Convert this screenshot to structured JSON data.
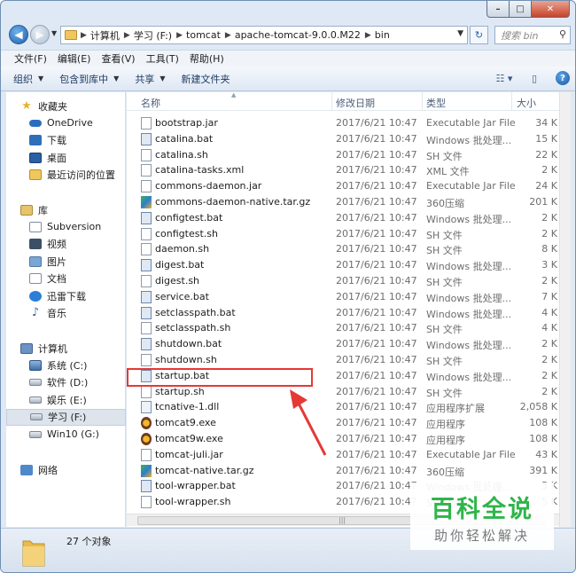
{
  "window": {
    "captions": {
      "min": "–",
      "max": "□",
      "close": "✕"
    }
  },
  "address": {
    "breadcrumbs": [
      "计算机",
      "学习 (F:)",
      "tomcat",
      "apache-tomcat-9.0.0.M22",
      "bin"
    ],
    "search_placeholder": "搜索 bin"
  },
  "menu": [
    "文件(F)",
    "编辑(E)",
    "查看(V)",
    "工具(T)",
    "帮助(H)"
  ],
  "toolbar": {
    "organize": "组织",
    "include_library": "包含到库中",
    "share": "共享",
    "new_folder": "新建文件夹"
  },
  "nav": {
    "favorites": {
      "title": "收藏夹",
      "items": [
        "OneDrive",
        "下载",
        "桌面",
        "最近访问的位置"
      ]
    },
    "library": {
      "title": "库",
      "items": [
        "Subversion",
        "视频",
        "图片",
        "文档",
        "迅雷下载",
        "音乐"
      ]
    },
    "computer": {
      "title": "计算机",
      "items": [
        "系统 (C:)",
        "软件 (D:)",
        "娱乐 (E:)",
        "学习 (F:)",
        "Win10 (G:)"
      ]
    },
    "network": {
      "title": "网络"
    }
  },
  "columns": {
    "name": "名称",
    "date": "修改日期",
    "type": "类型",
    "size": "大小"
  },
  "files": [
    {
      "name": "bootstrap.jar",
      "date": "2017/6/21 10:47",
      "type": "Executable Jar File",
      "size": "34 K",
      "icon": "file"
    },
    {
      "name": "catalina.bat",
      "date": "2017/6/21 10:47",
      "type": "Windows 批处理...",
      "size": "15 K",
      "icon": "bat"
    },
    {
      "name": "catalina.sh",
      "date": "2017/6/21 10:47",
      "type": "SH 文件",
      "size": "22 K",
      "icon": "file"
    },
    {
      "name": "catalina-tasks.xml",
      "date": "2017/6/21 10:47",
      "type": "XML 文件",
      "size": "2 K",
      "icon": "file"
    },
    {
      "name": "commons-daemon.jar",
      "date": "2017/6/21 10:47",
      "type": "Executable Jar File",
      "size": "24 K",
      "icon": "file"
    },
    {
      "name": "commons-daemon-native.tar.gz",
      "date": "2017/6/21 10:47",
      "type": "360压缩",
      "size": "201 K",
      "icon": "gz"
    },
    {
      "name": "configtest.bat",
      "date": "2017/6/21 10:47",
      "type": "Windows 批处理...",
      "size": "2 K",
      "icon": "bat"
    },
    {
      "name": "configtest.sh",
      "date": "2017/6/21 10:47",
      "type": "SH 文件",
      "size": "2 K",
      "icon": "file"
    },
    {
      "name": "daemon.sh",
      "date": "2017/6/21 10:47",
      "type": "SH 文件",
      "size": "8 K",
      "icon": "file"
    },
    {
      "name": "digest.bat",
      "date": "2017/6/21 10:47",
      "type": "Windows 批处理...",
      "size": "3 K",
      "icon": "bat"
    },
    {
      "name": "digest.sh",
      "date": "2017/6/21 10:47",
      "type": "SH 文件",
      "size": "2 K",
      "icon": "file"
    },
    {
      "name": "service.bat",
      "date": "2017/6/21 10:47",
      "type": "Windows 批处理...",
      "size": "7 K",
      "icon": "bat"
    },
    {
      "name": "setclasspath.bat",
      "date": "2017/6/21 10:47",
      "type": "Windows 批处理...",
      "size": "4 K",
      "icon": "bat"
    },
    {
      "name": "setclasspath.sh",
      "date": "2017/6/21 10:47",
      "type": "SH 文件",
      "size": "4 K",
      "icon": "file"
    },
    {
      "name": "shutdown.bat",
      "date": "2017/6/21 10:47",
      "type": "Windows 批处理...",
      "size": "2 K",
      "icon": "bat"
    },
    {
      "name": "shutdown.sh",
      "date": "2017/6/21 10:47",
      "type": "SH 文件",
      "size": "2 K",
      "icon": "file"
    },
    {
      "name": "startup.bat",
      "date": "2017/6/21 10:47",
      "type": "Windows 批处理...",
      "size": "2 K",
      "icon": "bat"
    },
    {
      "name": "startup.sh",
      "date": "2017/6/21 10:47",
      "type": "SH 文件",
      "size": "2 K",
      "icon": "file"
    },
    {
      "name": "tcnative-1.dll",
      "date": "2017/6/21 10:47",
      "type": "应用程序扩展",
      "size": "2,058 K",
      "icon": "dll"
    },
    {
      "name": "tomcat9.exe",
      "date": "2017/6/21 10:47",
      "type": "应用程序",
      "size": "108 K",
      "icon": "exe"
    },
    {
      "name": "tomcat9w.exe",
      "date": "2017/6/21 10:47",
      "type": "应用程序",
      "size": "108 K",
      "icon": "exe"
    },
    {
      "name": "tomcat-juli.jar",
      "date": "2017/6/21 10:47",
      "type": "Executable Jar File",
      "size": "43 K",
      "icon": "file"
    },
    {
      "name": "tomcat-native.tar.gz",
      "date": "2017/6/21 10:47",
      "type": "360压缩",
      "size": "391 K",
      "icon": "gz"
    },
    {
      "name": "tool-wrapper.bat",
      "date": "2017/6/21 10:47",
      "type": "Windows 批处理...",
      "size": "5 K",
      "icon": "bat"
    },
    {
      "name": "tool-wrapper.sh",
      "date": "2017/6/21 10:47",
      "type": "SH 文件",
      "size": "5 K",
      "icon": "file"
    }
  ],
  "status": {
    "count": "27 个对象"
  },
  "watermark": {
    "title": "百科全说",
    "subtitle": "助你轻松解决"
  },
  "colors": {
    "highlight": "#e53935",
    "watermark_green": "#2fb54a"
  }
}
